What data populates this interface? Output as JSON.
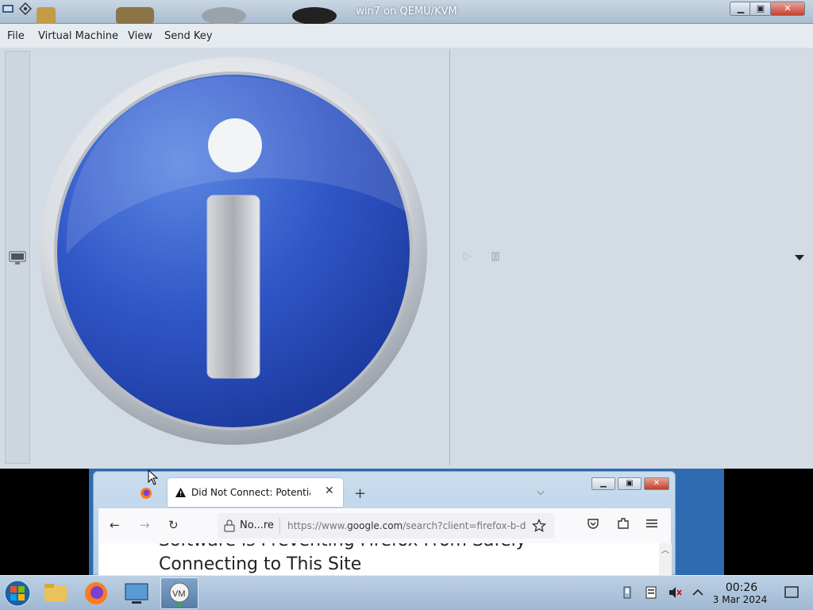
{
  "window": {
    "title": "win7 on QEMU/KVM"
  },
  "menu": {
    "items": [
      "File",
      "Virtual Machine",
      "View",
      "Send Key"
    ]
  },
  "firefox": {
    "tab_label": "Did Not Connect: Potential Sec",
    "url_site": "No...re",
    "url_prefix": "https://www.",
    "url_domain": "google.com",
    "url_rest": "/search?client=firefox-b-d",
    "heading_line1": "Software is Preventing Firefox From Safely",
    "heading_line2": "Connecting to This Site"
  },
  "taskbar": {
    "clock_time": "00:26",
    "clock_date": "3 Mar 2024",
    "apps": [
      "start-orb-icon",
      "file-explorer-icon",
      "firefox-icon",
      "remote-desktop-icon",
      "virt-manager-icon"
    ]
  },
  "colors": {
    "info_blue": "#2f55c6",
    "titlebar": "#b2c4d8",
    "taskbar": "#aec5dc"
  }
}
